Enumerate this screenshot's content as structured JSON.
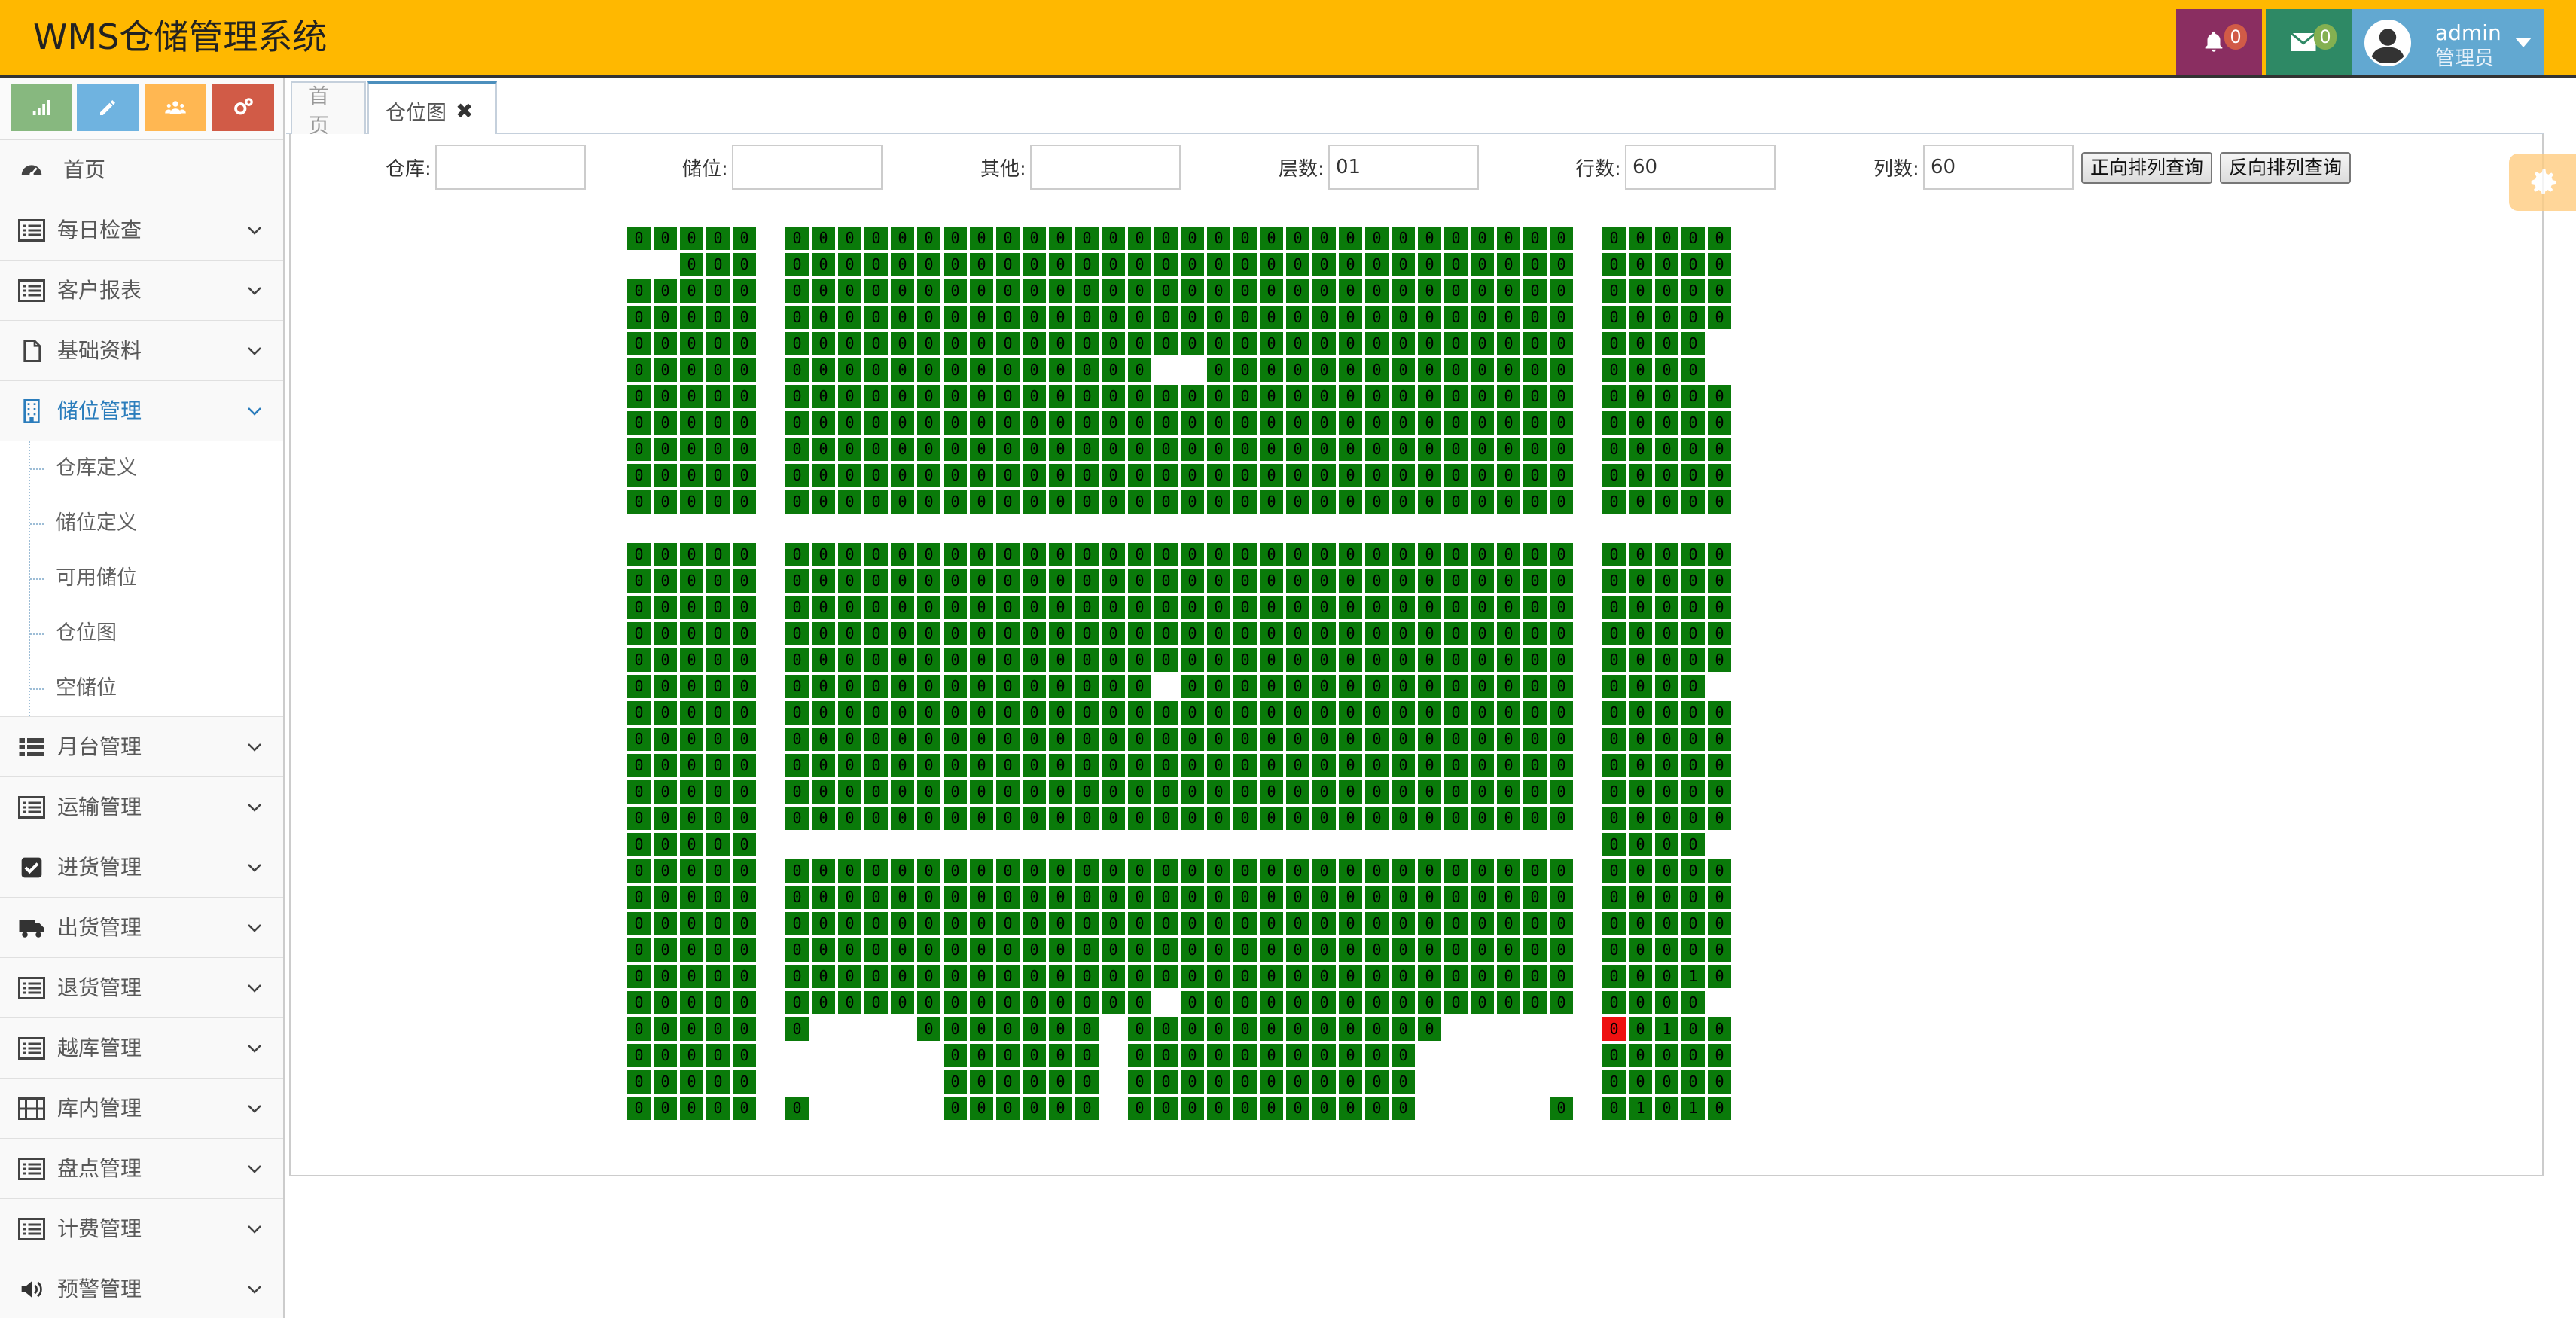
{
  "app": {
    "title": "WMS仓储管理系统"
  },
  "header": {
    "notifications_count": "0",
    "messages_count": "0",
    "user_name": "admin",
    "user_role": "管理员"
  },
  "shortcuts": [
    {
      "icon": "signal-icon",
      "color": "#87b87f"
    },
    {
      "icon": "pencil-icon",
      "color": "#6fb3e0"
    },
    {
      "icon": "users-icon",
      "color": "#ffb752"
    },
    {
      "icon": "cogs-icon",
      "color": "#d15b47"
    }
  ],
  "sidebar": {
    "home": "首页",
    "items_top": [
      "每日检查",
      "客户报表",
      "基础资料",
      "储位管理"
    ],
    "submenu": [
      "仓库定义",
      "储位定义",
      "可用储位",
      "仓位图",
      "空储位"
    ],
    "items_bottom": [
      "月台管理",
      "运输管理",
      "进货管理",
      "出货管理",
      "退货管理",
      "越库管理",
      "库内管理",
      "盘点管理",
      "计费管理",
      "预警管理"
    ]
  },
  "tabs": {
    "home": "首页",
    "current": "仓位图",
    "close": "✖"
  },
  "filters": {
    "warehouse_label": "仓库:",
    "warehouse_value": "",
    "location_label": "储位:",
    "location_value": "",
    "other_label": "其他:",
    "other_value": "",
    "layer_label": "层数:",
    "layer_value": "01",
    "rows_label": "行数:",
    "rows_value": "60",
    "cols_label": "列数:",
    "cols_value": "60",
    "forward_btn": "正向排列查询",
    "reverse_btn": "反向排列查询"
  },
  "grid": {
    "cell_value": "0",
    "occupied_value": "1",
    "colors": {
      "normal": "#0a7a0a",
      "alert": "#ee1111"
    }
  }
}
